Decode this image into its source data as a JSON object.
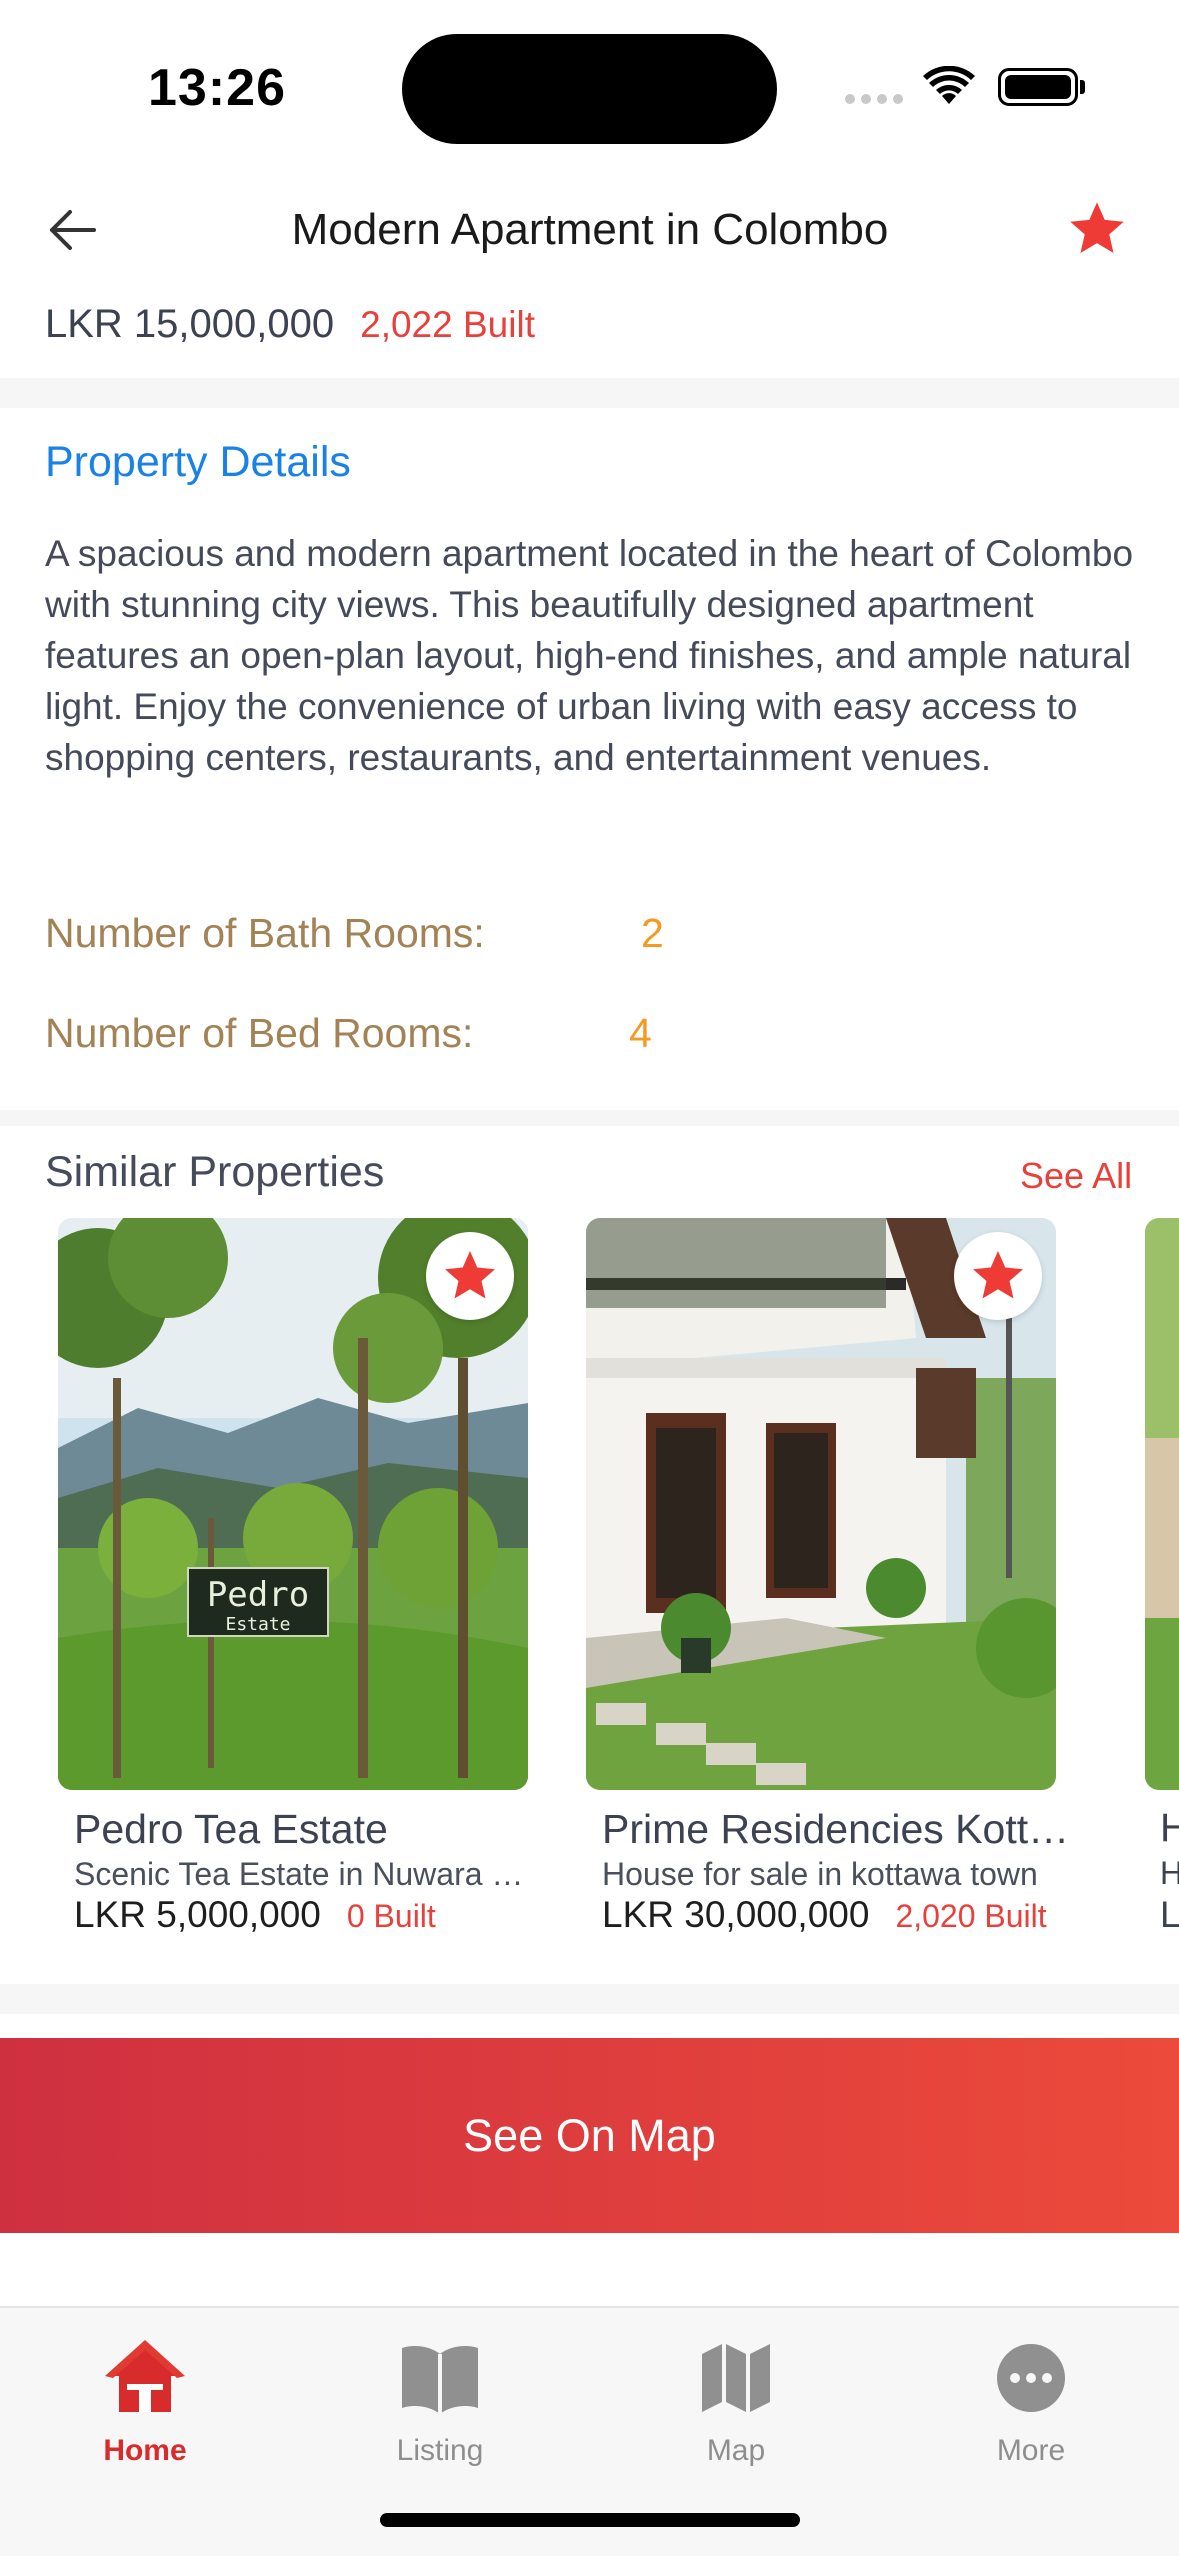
{
  "status_bar": {
    "time": "13:26"
  },
  "header": {
    "title": "Modern Apartment in Colombo"
  },
  "property": {
    "price": "LKR 15,000,000",
    "built": "2,022 Built",
    "details_title": "Property Details",
    "description": "A spacious and modern apartment located in the heart of Colombo with stunning city views. This beautifully designed apartment features an open-plan layout, high-end finishes, and ample natural light. Enjoy the convenience of urban living with easy access to shopping centers, restaurants, and entertainment venues.",
    "bath_label": "Number of Bath Rooms:",
    "bath_value": "2",
    "bed_label": "Number of Bed Rooms:",
    "bed_value": "4"
  },
  "similar": {
    "title": "Similar Properties",
    "see_all": "See All",
    "cards": [
      {
        "name": "Pedro Tea Estate",
        "subtitle": "Scenic Tea Estate in Nuwara Eliya",
        "price": "LKR 5,000,000",
        "built": "0 Built",
        "sign_text": "Pedro",
        "sign_sub": "Estate"
      },
      {
        "name": "Prime Residencies Kottawa",
        "subtitle": "House for sale in kottawa town",
        "price": "LKR 30,000,000",
        "built": "2,020 Built"
      }
    ],
    "peek_letters": [
      "H",
      "H",
      "L"
    ]
  },
  "map_button": {
    "label": "See On Map"
  },
  "tabbar": {
    "tabs": [
      {
        "label": "Home",
        "icon": "home-icon",
        "active": true
      },
      {
        "label": "Listing",
        "icon": "book-icon",
        "active": false
      },
      {
        "label": "Map",
        "icon": "map-icon",
        "active": false
      },
      {
        "label": "More",
        "icon": "more-icon",
        "active": false
      }
    ]
  },
  "colors": {
    "accent_red": "#e8413b",
    "link_blue": "#1a82e6",
    "stat_label": "#a38356",
    "stat_value": "#f59a21"
  }
}
